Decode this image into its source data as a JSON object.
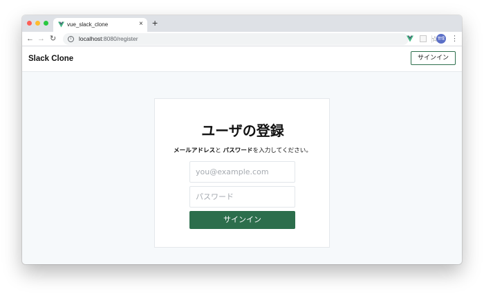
{
  "browser": {
    "tab_title": "vue_slack_clone",
    "tab_close": "×",
    "new_tab": "+",
    "url_host": "localhost",
    "url_path": ":8080/register",
    "avatar_text": "管理",
    "icons": {
      "back": "←",
      "forward": "→",
      "reload": "↻",
      "info": "i",
      "star": "☆",
      "menu": "⋮"
    },
    "colors": {
      "traffic_red": "#fe5f57",
      "traffic_yellow": "#febc2e",
      "traffic_green": "#28c840"
    }
  },
  "header": {
    "title": "Slack Clone",
    "signin_label": "サインイン"
  },
  "card": {
    "title": "ユーザの登録",
    "desc_email": "メールアドレス",
    "desc_and": "と ",
    "desc_password": "パスワード",
    "desc_tail": "を入力してください。",
    "email_placeholder": "you@example.com",
    "password_placeholder": "パスワード",
    "submit_label": "サインイン"
  },
  "theme": {
    "accent": "#2c6e4c",
    "page_bg": "#f6f9fb"
  }
}
